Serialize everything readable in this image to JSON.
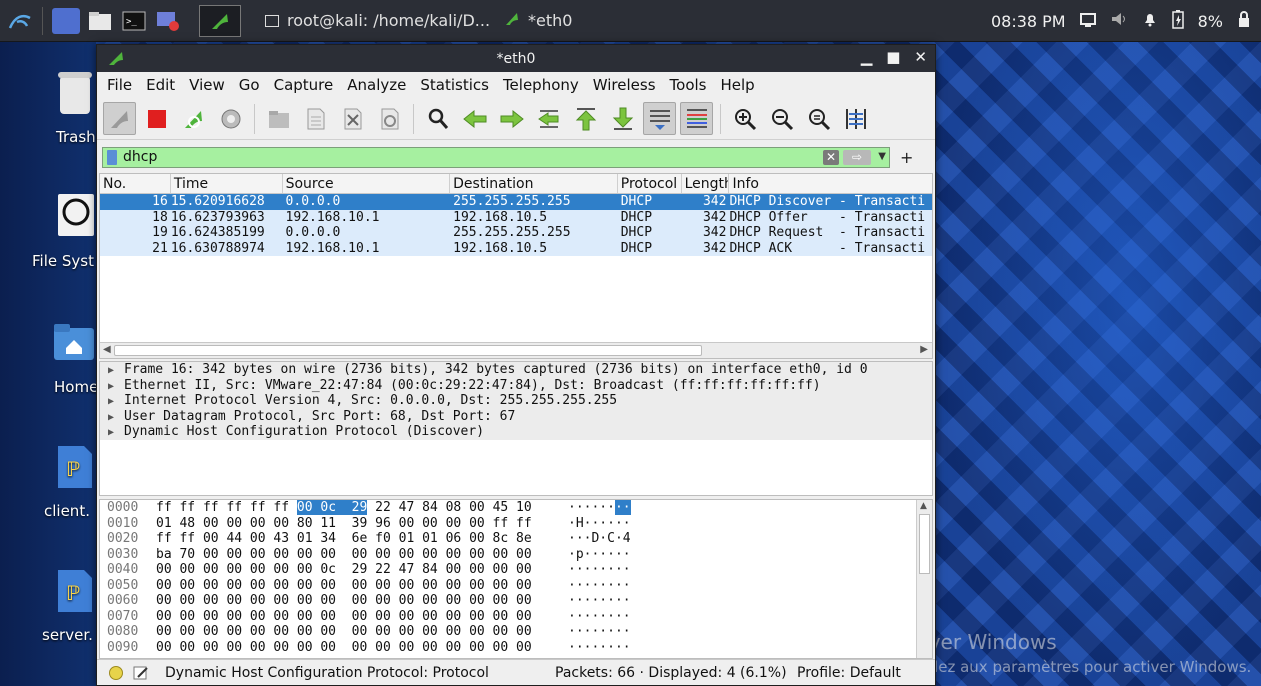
{
  "taskbar": {
    "window_terminal": "root@kali: /home/kali/D...",
    "window_wireshark": "*eth0",
    "time": "08:38 PM",
    "battery": "8%"
  },
  "desktop": {
    "icons": [
      "Trash",
      "File Syst",
      "Home",
      "client.",
      "server."
    ]
  },
  "window": {
    "title": "*eth0"
  },
  "menu": [
    "File",
    "Edit",
    "View",
    "Go",
    "Capture",
    "Analyze",
    "Statistics",
    "Telephony",
    "Wireless",
    "Tools",
    "Help"
  ],
  "filter": {
    "value": "dhcp"
  },
  "packet_list": {
    "columns": [
      "No.",
      "Time",
      "Source",
      "Destination",
      "Protocol",
      "Length",
      "Info"
    ],
    "rows": [
      {
        "no": "16",
        "time": "15.620916628",
        "src": "0.0.0.0",
        "dst": "255.255.255.255",
        "proto": "DHCP",
        "len": "342",
        "info": "DHCP Discover - Transacti"
      },
      {
        "no": "18",
        "time": "16.623793963",
        "src": "192.168.10.1",
        "dst": "192.168.10.5",
        "proto": "DHCP",
        "len": "342",
        "info": "DHCP Offer    - Transacti"
      },
      {
        "no": "19",
        "time": "16.624385199",
        "src": "0.0.0.0",
        "dst": "255.255.255.255",
        "proto": "DHCP",
        "len": "342",
        "info": "DHCP Request  - Transacti"
      },
      {
        "no": "21",
        "time": "16.630788974",
        "src": "192.168.10.1",
        "dst": "192.168.10.5",
        "proto": "DHCP",
        "len": "342",
        "info": "DHCP ACK      - Transacti"
      }
    ]
  },
  "details": [
    "Frame 16: 342 bytes on wire (2736 bits), 342 bytes captured (2736 bits) on interface eth0, id 0",
    "Ethernet II, Src: VMware_22:47:84 (00:0c:29:22:47:84), Dst: Broadcast (ff:ff:ff:ff:ff:ff)",
    "Internet Protocol Version 4, Src: 0.0.0.0, Dst: 255.255.255.255",
    "User Datagram Protocol, Src Port: 68, Dst Port: 67",
    "Dynamic Host Configuration Protocol (Discover)"
  ],
  "bytes": [
    {
      "off": "0000",
      "pre": "ff ff ff ff ff ff ",
      "hl": "00 0c  29",
      "post": " 22 47 84 08 00 45 10",
      "asc_pre": "······",
      "asc_hl": "··",
      "asc_post": ""
    },
    {
      "off": "0010",
      "pre": "01 48 00 00 00 00 80 11  39 96 00 00 00 00 ff ff",
      "hl": "",
      "post": "",
      "asc_pre": "·H······",
      "asc_hl": "",
      "asc_post": ""
    },
    {
      "off": "0020",
      "pre": "ff ff 00 44 00 43 01 34  6e f0 01 01 06 00 8c 8e",
      "hl": "",
      "post": "",
      "asc_pre": "···D·C·4",
      "asc_hl": "",
      "asc_post": ""
    },
    {
      "off": "0030",
      "pre": "ba 70 00 00 00 00 00 00  00 00 00 00 00 00 00 00",
      "hl": "",
      "post": "",
      "asc_pre": "·p······",
      "asc_hl": "",
      "asc_post": ""
    },
    {
      "off": "0040",
      "pre": "00 00 00 00 00 00 00 0c  29 22 47 84 00 00 00 00",
      "hl": "",
      "post": "",
      "asc_pre": "········",
      "asc_hl": "",
      "asc_post": ""
    },
    {
      "off": "0050",
      "pre": "00 00 00 00 00 00 00 00  00 00 00 00 00 00 00 00",
      "hl": "",
      "post": "",
      "asc_pre": "········",
      "asc_hl": "",
      "asc_post": ""
    },
    {
      "off": "0060",
      "pre": "00 00 00 00 00 00 00 00  00 00 00 00 00 00 00 00",
      "hl": "",
      "post": "",
      "asc_pre": "········",
      "asc_hl": "",
      "asc_post": ""
    },
    {
      "off": "0070",
      "pre": "00 00 00 00 00 00 00 00  00 00 00 00 00 00 00 00",
      "hl": "",
      "post": "",
      "asc_pre": "········",
      "asc_hl": "",
      "asc_post": ""
    },
    {
      "off": "0080",
      "pre": "00 00 00 00 00 00 00 00  00 00 00 00 00 00 00 00",
      "hl": "",
      "post": "",
      "asc_pre": "········",
      "asc_hl": "",
      "asc_post": ""
    },
    {
      "off": "0090",
      "pre": "00 00 00 00 00 00 00 00  00 00 00 00 00 00 00 00",
      "hl": "",
      "post": "",
      "asc_pre": "········",
      "asc_hl": "",
      "asc_post": ""
    }
  ],
  "status": {
    "protocol": "Dynamic Host Configuration Protocol: Protocol",
    "packets": "Packets: 66 · Displayed: 4 (6.1%)",
    "profile": "Profile: Default"
  },
  "watermark": {
    "title": "Activer Windows",
    "subtitle": "Accédez aux paramètres pour activer Windows."
  },
  "colors": {
    "filter_ok": "#a6f0a0",
    "selected_row": "#2f7fc9",
    "row_bg": "#dcebfb"
  }
}
